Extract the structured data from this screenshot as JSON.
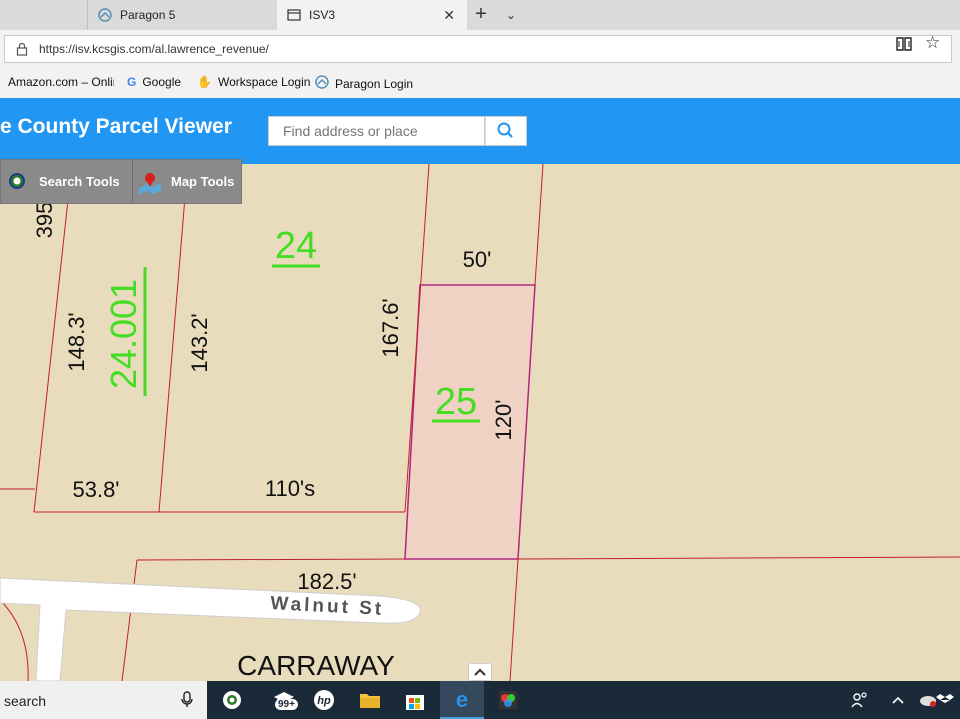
{
  "browser": {
    "tabs": [
      {
        "label": "Paragon 5",
        "icon": "paragon-icon"
      },
      {
        "label": "ISV3",
        "icon": "page-icon"
      }
    ],
    "new_tab_label": "+",
    "tab_menu_label": "⌄",
    "url": "https://isv.kcsgis.com/al.lawrence_revenue/",
    "favorites": [
      {
        "label": "Amazon.com – Onlin"
      },
      {
        "label": "Google",
        "icon": "G"
      },
      {
        "label": "Workspace Login"
      },
      {
        "label": "Paragon Login"
      }
    ]
  },
  "app": {
    "title": "e County Parcel Viewer",
    "search": {
      "placeholder": "Find address or place",
      "value": ""
    },
    "tools": {
      "search_label": "Search Tools",
      "map_label": "Map Tools"
    },
    "colors": {
      "header": "#2196f3",
      "selected_parcel": "#efd2c4",
      "parcel_line": "#c0202a",
      "lot_number": "#3fdc20",
      "map_bg": "#e8dcbc"
    }
  },
  "map": {
    "lot_numbers": [
      "24",
      "24.001",
      "25"
    ],
    "dimensions": {
      "d395": "395",
      "d1483": "148.3'",
      "d1432": "143.2'",
      "d1676": "167.6'",
      "d50": "50'",
      "d120": "120'",
      "d538": "53.8'",
      "d110s": "110's",
      "d1825": "182.5'"
    },
    "street": "Walnut St",
    "area_label": "CARRAWAY"
  },
  "taskbar": {
    "search_label": "search",
    "badge": "99+"
  }
}
